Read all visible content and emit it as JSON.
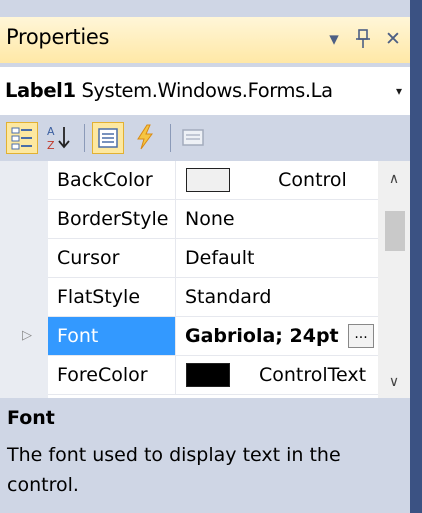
{
  "panel": {
    "title": "Properties",
    "buttons": {
      "dropdown_icon": "▾",
      "pin_icon": "ѥ",
      "close_icon": "✕"
    }
  },
  "selector": {
    "object_name": "Label1",
    "object_type": "System.Windows.Forms.La",
    "dropdown_icon": "▾"
  },
  "toolbar": {
    "buttons": [
      "categorized-icon",
      "alphabetical-icon",
      "properties-icon",
      "events-icon",
      "property-pages-icon"
    ],
    "active": [
      "categorized",
      "properties"
    ]
  },
  "grid": {
    "rows": [
      {
        "name": "BackColor",
        "value": "Control",
        "swatch": "#f0f0f0"
      },
      {
        "name": "BorderStyle",
        "value": "None"
      },
      {
        "name": "Cursor",
        "value": "Default"
      },
      {
        "name": "FlatStyle",
        "value": "Standard"
      },
      {
        "name": "Font",
        "value": "Gabriola; 24pt",
        "selected": true,
        "expandable": true,
        "ellipsis": "..."
      },
      {
        "name": "ForeColor",
        "value": "ControlText",
        "swatch": "#000000"
      }
    ],
    "scroll_up_icon": "∧",
    "scroll_down_icon": "∨",
    "expander_icon": "▷"
  },
  "description": {
    "title": "Font",
    "text": "The font used to display text in the control."
  },
  "colors": {
    "selection": "#3399ff",
    "titlebar": "#ffe8a6",
    "panel": "#cfd6e5",
    "frame": "#3b5283"
  }
}
